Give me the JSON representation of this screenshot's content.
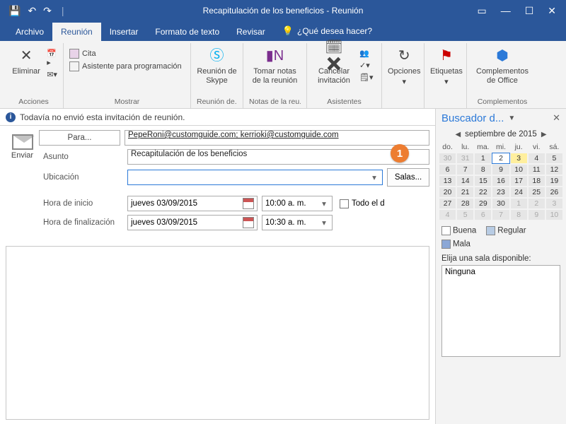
{
  "window": {
    "title": "Recapitulación de los beneficios  -  Reunión",
    "controls": {
      "restore": "▭",
      "minimize": "—",
      "maximize": "☐",
      "close": "✕",
      "chevron": "▾"
    }
  },
  "tabs": {
    "file": "Archivo",
    "meeting": "Reunión",
    "insert": "Insertar",
    "format": "Formato de texto",
    "review": "Revisar",
    "tell_me": "¿Qué desea hacer?"
  },
  "ribbon": {
    "actions": {
      "delete": "Eliminar",
      "label": "Acciones"
    },
    "show": {
      "appointment": "Cita",
      "scheduling": "Asistente para programación",
      "label": "Mostrar"
    },
    "skype": {
      "btn": "Reunión de Skype",
      "label": "Reunión de..."
    },
    "notes": {
      "btn": "Tomar notas de la reunión",
      "label": "Notas de la reu..."
    },
    "attendees": {
      "cancel": "Cancelar invitación",
      "label": "Asistentes"
    },
    "options": {
      "btn": "Opciones",
      "label": ""
    },
    "tags": {
      "btn": "Etiquetas",
      "label": ""
    },
    "addins": {
      "btn": "Complementos de Office",
      "label": "Complementos"
    }
  },
  "infobar": "Todavía no envió esta invitación de reunión.",
  "form": {
    "send": "Enviar",
    "to_btn": "Para...",
    "to_value": "PepeRoni@customguide.com; kerrioki@customguide.com",
    "subject_lbl": "Asunto",
    "subject_value": "Recapitulación de los beneficios",
    "location_lbl": "Ubicación",
    "location_value": "",
    "rooms_btn": "Salas...",
    "start_lbl": "Hora de inicio",
    "start_date": "jueves 03/09/2015",
    "start_time": "10:00 a. m.",
    "end_lbl": "Hora de finalización",
    "end_date": "jueves 03/09/2015",
    "end_time": "10:30 a. m.",
    "allday": "Todo el d"
  },
  "panel": {
    "title": "Buscador d...",
    "month": "septiembre de 2015",
    "dow": [
      "do.",
      "lu.",
      "ma.",
      "mi.",
      "ju.",
      "vi.",
      "sá."
    ],
    "legend": {
      "good": "Buena",
      "fair": "Regular",
      "poor": "Mala"
    },
    "room_prompt": "Elija una sala disponible:",
    "room_none": "Ninguna"
  },
  "callout": {
    "n1": "1"
  }
}
